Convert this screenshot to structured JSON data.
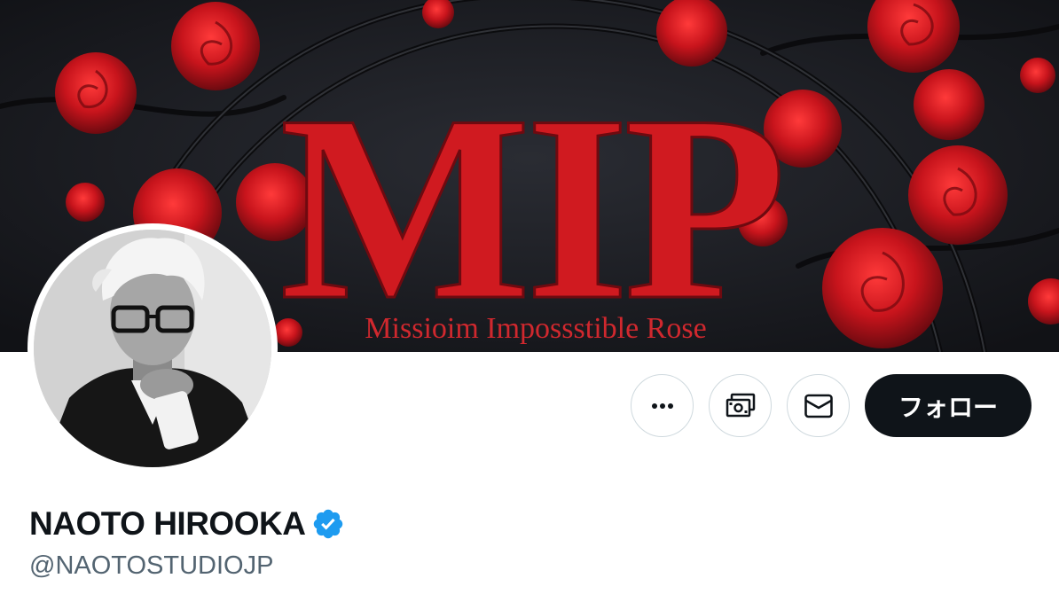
{
  "banner": {
    "logo_text": "MIP",
    "tagline": "Missioim Impossstible Rose",
    "colors": {
      "background": "#1a1c21",
      "rose": "#c8141c",
      "logo": "#d01a20"
    }
  },
  "profile": {
    "display_name": "NAOTO HIROOKA",
    "handle": "@NAOTOSTUDIOJP",
    "verified": true,
    "verified_color": "#1d9bf0"
  },
  "actions": {
    "more_icon": "more-icon",
    "tip_icon": "money-icon",
    "message_icon": "mail-icon",
    "follow_label": "フォロー"
  }
}
